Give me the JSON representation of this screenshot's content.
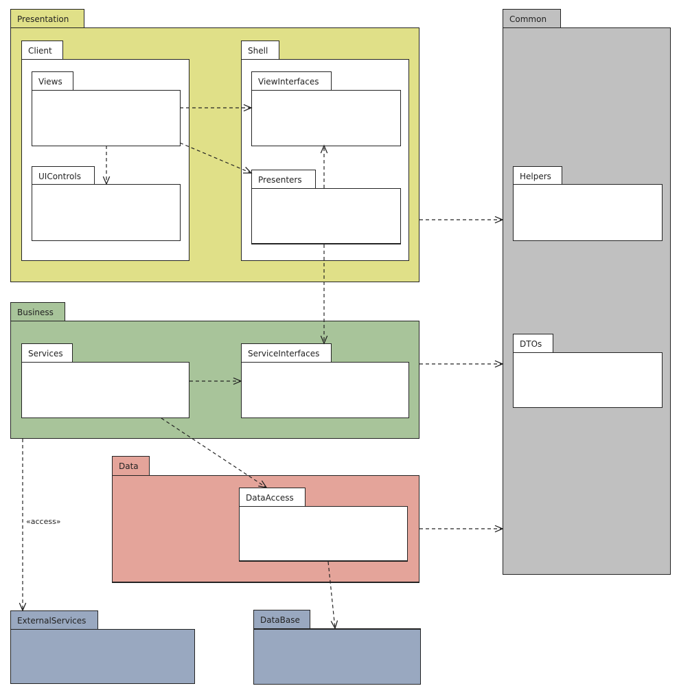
{
  "packages": {
    "presentation": {
      "name": "Presentation",
      "color": "#e0e088"
    },
    "client": {
      "name": "Client"
    },
    "views": {
      "name": "Views"
    },
    "uicontrols": {
      "name": "UIControls"
    },
    "shell": {
      "name": "Shell"
    },
    "viewinterfaces": {
      "name": "ViewInterfaces"
    },
    "presenters": {
      "name": "Presenters"
    },
    "common": {
      "name": "Common",
      "color": "#c0c0c0"
    },
    "helpers": {
      "name": "Helpers"
    },
    "dtos": {
      "name": "DTOs"
    },
    "business": {
      "name": "Business",
      "color": "#a8c49a"
    },
    "services": {
      "name": "Services"
    },
    "serviceinterfaces": {
      "name": "ServiceInterfaces"
    },
    "data": {
      "name": "Data",
      "color": "#e4a49a"
    },
    "dataaccess": {
      "name": "DataAccess"
    },
    "externalservices": {
      "name": "ExternalServices",
      "color": "#99a8c0"
    },
    "database": {
      "name": "DataBase",
      "color": "#99a8c0"
    }
  },
  "dependencies": [
    {
      "from": "Views",
      "to": "ViewInterfaces"
    },
    {
      "from": "Views",
      "to": "Presenters"
    },
    {
      "from": "Views",
      "to": "UIControls"
    },
    {
      "from": "Presenters",
      "to": "ViewInterfaces"
    },
    {
      "from": "Presenters",
      "to": "ServiceInterfaces"
    },
    {
      "from": "Presentation",
      "to": "Common"
    },
    {
      "from": "Business",
      "to": "Common"
    },
    {
      "from": "Data",
      "to": "Common"
    },
    {
      "from": "Services",
      "to": "ServiceInterfaces"
    },
    {
      "from": "Services",
      "to": "DataAccess"
    },
    {
      "from": "Business",
      "to": "ExternalServices",
      "label": "«access»"
    },
    {
      "from": "DataAccess",
      "to": "DataBase"
    }
  ]
}
